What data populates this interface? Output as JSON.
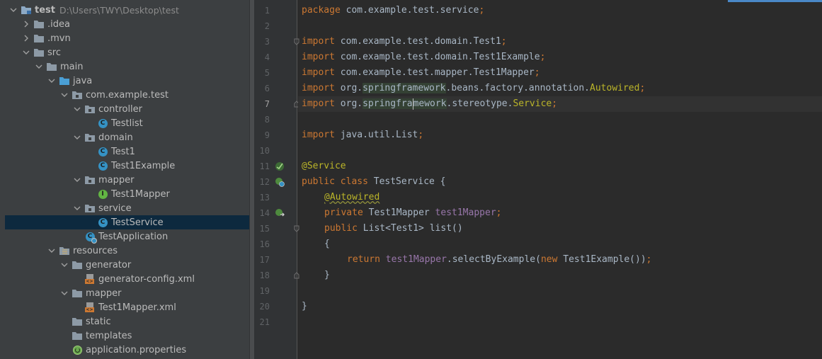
{
  "project": {
    "root": {
      "label": "test",
      "path": "D:\\Users\\TWY\\Desktop\\test"
    },
    "items": [
      {
        "label": ".idea"
      },
      {
        "label": ".mvn"
      },
      {
        "label": "src"
      },
      {
        "label": "main"
      },
      {
        "label": "java"
      },
      {
        "label": "com.example.test"
      },
      {
        "label": "controller"
      },
      {
        "label": "Testlist"
      },
      {
        "label": "domain"
      },
      {
        "label": "Test1"
      },
      {
        "label": "Test1Example"
      },
      {
        "label": "mapper"
      },
      {
        "label": "Test1Mapper"
      },
      {
        "label": "service"
      },
      {
        "label": "TestService"
      },
      {
        "label": "TestApplication"
      },
      {
        "label": "resources"
      },
      {
        "label": "generator"
      },
      {
        "label": "generator-config.xml"
      },
      {
        "label": "mapper"
      },
      {
        "label": "Test1Mapper.xml"
      },
      {
        "label": "static"
      },
      {
        "label": "templates"
      },
      {
        "label": "application.properties"
      }
    ]
  },
  "editor": {
    "current_line": 7,
    "line_numbers": [
      "1",
      "2",
      "3",
      "4",
      "5",
      "6",
      "7",
      "8",
      "9",
      "10",
      "11",
      "12",
      "13",
      "14",
      "15",
      "16",
      "17",
      "18",
      "19",
      "20",
      "21"
    ],
    "tokens": {
      "l1_kw": "package",
      "l1_rest": " com.example.test.service",
      "l1_semi": ";",
      "import": "import",
      "l3_rest": " com.example.test.domain.Test1",
      "l4_rest": " com.example.test.domain.Test1Example",
      "l5_rest": " com.example.test.mapper.Test1Mapper",
      "l6_a": " org.",
      "l6_spring": "springframework",
      "l6_b": ".beans.factory.annotation.",
      "l6_c": "Autowired",
      "l7_a": " org.",
      "l7_spring1": "springfra",
      "l7_spring2": "mework",
      "l7_b": ".stereotype.",
      "l7_c": "Service",
      "l9_rest": " java.util.List",
      "semi": ";",
      "l11_ann": "@Service",
      "l12_kw": "public class",
      "l12_rest": " TestService {",
      "l13_ann": "@Autowired",
      "l14_kw": "private",
      "l14_type": " Test1Mapper ",
      "l14_fld": "test1Mapper",
      "l15_kw": "public",
      "l15_rest": " List<Test1> list()",
      "brace_open": "{",
      "l17_kw": "return",
      "l17_fld": "test1Mapper",
      "l17_call": ".selectByExample(",
      "l17_new": "new",
      "l17_rest": " Test1Example())",
      "brace_close": "}",
      "l20": "}"
    }
  }
}
